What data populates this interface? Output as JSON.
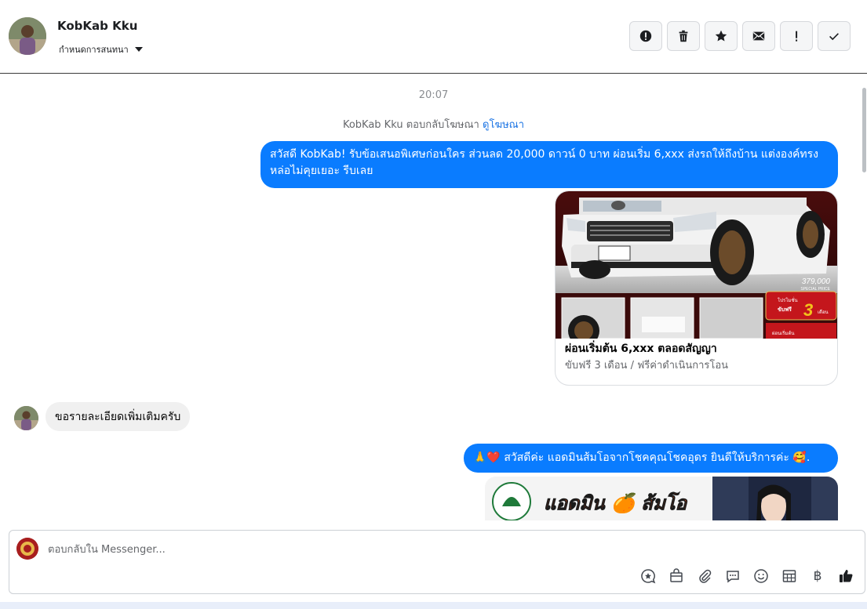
{
  "header": {
    "user_name": "KobKab Kku",
    "conversation_label": "กำหนดการสนทนา",
    "actions": [
      {
        "name": "report-icon",
        "symbol": "!"
      },
      {
        "name": "trash-icon",
        "symbol": ""
      },
      {
        "name": "star-icon",
        "symbol": ""
      },
      {
        "name": "mail-icon",
        "symbol": ""
      },
      {
        "name": "important-icon",
        "symbol": "!"
      },
      {
        "name": "check-icon",
        "symbol": ""
      }
    ]
  },
  "messages": {
    "time": "20:07",
    "ad_note_prefix": "KobKab Kku ตอบกลับโฆษณา",
    "ad_note_link": "ดูโฆษณา",
    "outgoing_1": "สวัสดี KobKab! รับข้อเสนอพิเศษก่อนใคร ส่วนลด 20,000 ดาวน์ 0 บาท ผ่อนเริ่ม 6,xxx ส่งรถให้ถึงบ้าน แต่งองค์ทรงหล่อไม่คุยเยอะ รีบเลย",
    "card": {
      "image_price": "379,000",
      "image_price_label": "SPECIAL PRICE",
      "image_promo_top": "โปรโมชั่น",
      "image_promo_mid": "ขับฟรี",
      "image_promo_num": "3",
      "image_promo_unit": "เดือน",
      "image_promo_bottom": "ผ่อนเริ่มต้น",
      "title": "ผ่อนเริ่มต้น 6,xxx ตลอดสัญญา",
      "subtitle": "ขับฟรี 3 เดือน / ฟรีค่าดำเนินการโอน"
    },
    "incoming_1": "ขอรายละเอียดเพิ่มเติมครับ",
    "outgoing_2": "🙏❤️ สวัสดีค่ะ แอดมินส้มโอจากโชคคุณโชคอุดร ยินดีให้บริการค่ะ 🥰.",
    "image2_text": "แอดมิน 🍊 ส้มโอ"
  },
  "composer": {
    "placeholder": "ตอบกลับใน Messenger...",
    "baht_symbol": "฿"
  },
  "colors": {
    "accent": "#0a7cff",
    "incoming_bubble": "#f0f0f0",
    "muted_text": "#65676b",
    "link": "#1b74e4"
  }
}
